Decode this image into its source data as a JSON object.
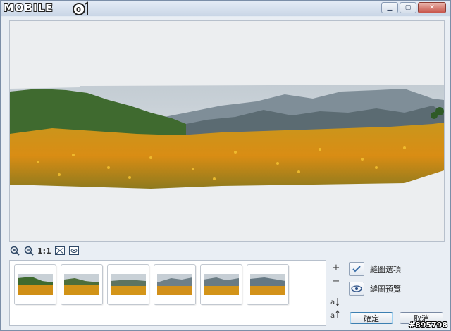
{
  "window": {
    "brand": "MOBILE",
    "brand_logo": "mobile01-logo",
    "minimize_icon": "minimize-icon",
    "maximize_icon": "maximize-icon",
    "close_icon": "close-icon"
  },
  "toolbar": {
    "zoom_in_icon": "zoom-in-icon",
    "zoom_out_icon": "zoom-out-icon",
    "actual_size_label": "1:1",
    "fit_icon": "fit-window-icon",
    "preview_icon": "eye-preview-icon"
  },
  "thumbnails": [
    {
      "label": "photo-1"
    },
    {
      "label": "photo-2"
    },
    {
      "label": "photo-3"
    },
    {
      "label": "photo-4"
    },
    {
      "label": "photo-5"
    },
    {
      "label": "photo-6"
    }
  ],
  "side": {
    "add_label": "+",
    "remove_label": "−",
    "sort_asc_icon": "sort-asc-icon",
    "sort_desc_icon": "sort-desc-icon",
    "stitch_options_label": "縫圖選項",
    "stitch_preview_label": "縫圖預覽"
  },
  "buttons": {
    "ok_label": "確定",
    "cancel_label": "取消"
  },
  "watermark": "#895798"
}
